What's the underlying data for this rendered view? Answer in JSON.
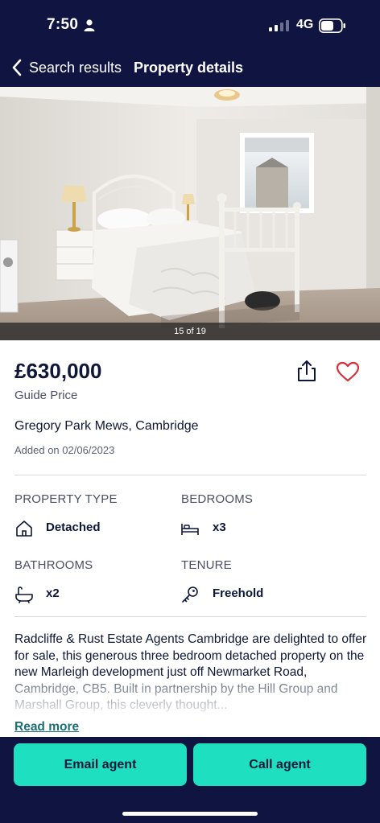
{
  "status_bar": {
    "time": "7:50",
    "network": "4G"
  },
  "nav": {
    "back_label": "Search results",
    "title": "Property details"
  },
  "gallery": {
    "counter": "15 of 19"
  },
  "listing": {
    "price": "£630,000",
    "price_qualifier": "Guide Price",
    "address": "Gregory Park Mews, Cambridge",
    "added": "Added on 02/06/2023"
  },
  "key_features": [
    {
      "label": "PROPERTY TYPE",
      "value": "Detached",
      "icon": "house-icon"
    },
    {
      "label": "BEDROOMS",
      "value": "x3",
      "icon": "bed-icon"
    },
    {
      "label": "BATHROOMS",
      "value": "x2",
      "icon": "bath-icon"
    },
    {
      "label": "TENURE",
      "value": "Freehold",
      "icon": "key-icon"
    }
  ],
  "description": {
    "text": "Radcliffe & Rust Estate Agents Cambridge are delighted to offer for sale, this generous three bedroom detached property on the new Marleigh development just off Newmarket Road, Cambridge, CB5. Built in partnership by the Hill Group and Marshall Group, this cleverly thought...",
    "read_more": "Read more"
  },
  "actions": {
    "email": "Email agent",
    "call": "Call agent"
  },
  "colors": {
    "navy": "#0f1440",
    "accent": "#1ee0c0",
    "heart": "#d6313a",
    "link": "#1a6e75"
  }
}
